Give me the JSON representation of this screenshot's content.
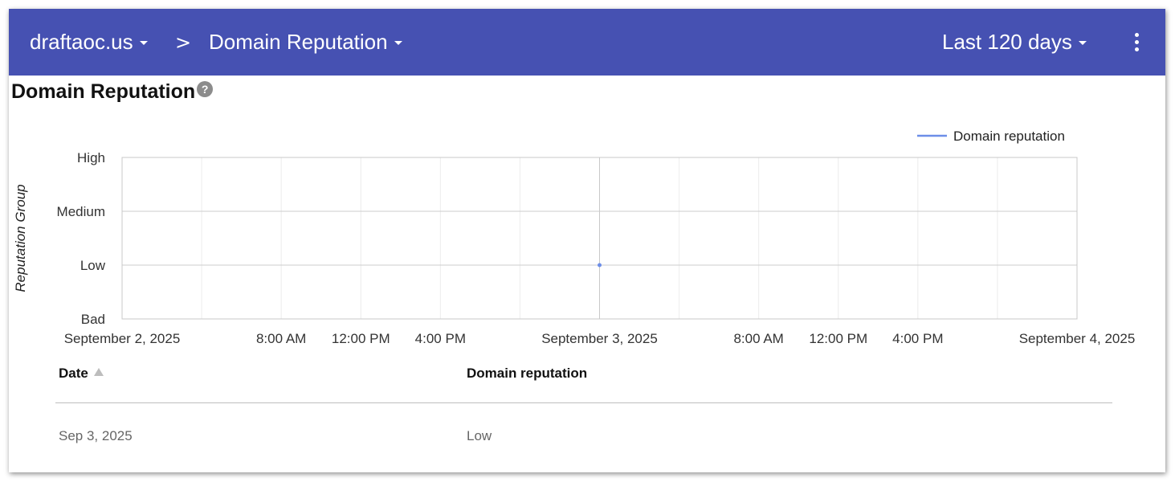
{
  "topbar": {
    "domain_label": "draftaoc.us",
    "separator": ">",
    "page_label": "Domain Reputation",
    "range_label": "Last 120 days"
  },
  "colors": {
    "topbar_bg": "#4651b2",
    "series": "#6d8ee8"
  },
  "section": {
    "title": "Domain Reputation",
    "help": "?"
  },
  "chart_data": {
    "type": "line",
    "title": "",
    "ylabel": "Reputation Group",
    "xlabel": "",
    "legend": {
      "position": "top-right",
      "entries": [
        "Domain reputation"
      ]
    },
    "y_categories": [
      "Bad",
      "Low",
      "Medium",
      "High"
    ],
    "x_ticks": [
      "September 2, 2025",
      "8:00 AM",
      "12:00 PM",
      "4:00 PM",
      "September 3, 2025",
      "8:00 AM",
      "12:00 PM",
      "4:00 PM",
      "September 4, 2025"
    ],
    "xlim": [
      "2025-09-02T00:00",
      "2025-09-04T00:00"
    ],
    "grid": true,
    "series": [
      {
        "name": "Domain reputation",
        "points": [
          {
            "x": "2025-09-03T00:00",
            "y": "Low"
          }
        ]
      }
    ]
  },
  "table": {
    "headers": [
      "Date",
      "Domain reputation"
    ],
    "rows": [
      [
        "Sep 3, 2025",
        "Low"
      ]
    ]
  }
}
